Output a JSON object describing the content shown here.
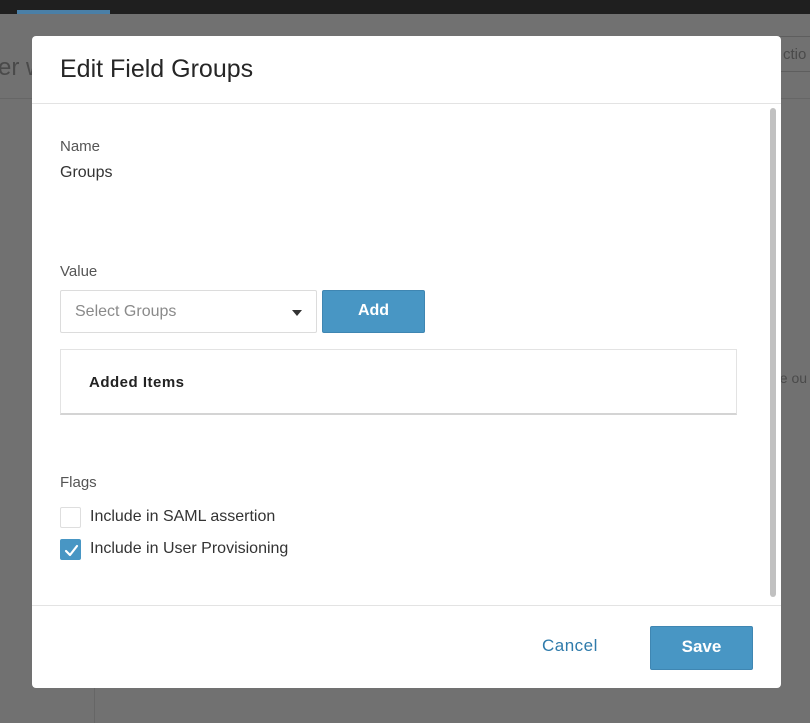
{
  "background": {
    "title_fragment": "er w",
    "action_fragment": "ctio",
    "text_fragment": "ue ou"
  },
  "modal": {
    "title": "Edit Field Groups",
    "name_label": "Name",
    "name_value": "Groups",
    "value_label": "Value",
    "select_placeholder": "Select Groups",
    "add_label": "Add",
    "added_items_title": "Added Items",
    "flags_label": "Flags",
    "flags": [
      {
        "label": "Include in SAML assertion",
        "checked": false
      },
      {
        "label": "Include in User Provisioning",
        "checked": true
      }
    ],
    "cancel_label": "Cancel",
    "save_label": "Save"
  },
  "colors": {
    "accent": "#4896c4",
    "link": "#2f7bab"
  },
  "icons": {
    "dropdown": "chevron-down-icon",
    "check": "checkmark-icon"
  }
}
